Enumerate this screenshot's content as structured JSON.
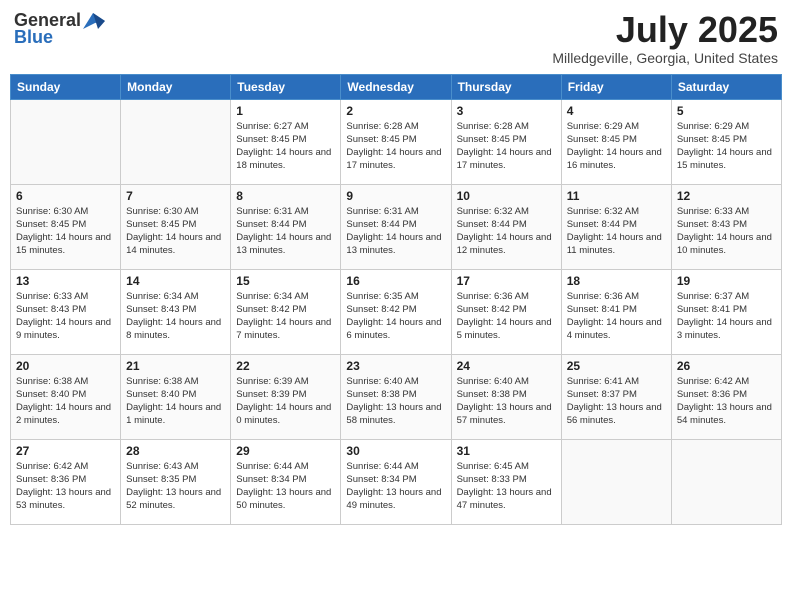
{
  "header": {
    "logo_general": "General",
    "logo_blue": "Blue",
    "month": "July 2025",
    "location": "Milledgeville, Georgia, United States"
  },
  "days_of_week": [
    "Sunday",
    "Monday",
    "Tuesday",
    "Wednesday",
    "Thursday",
    "Friday",
    "Saturday"
  ],
  "weeks": [
    [
      {
        "day": "",
        "info": ""
      },
      {
        "day": "",
        "info": ""
      },
      {
        "day": "1",
        "info": "Sunrise: 6:27 AM\nSunset: 8:45 PM\nDaylight: 14 hours and 18 minutes."
      },
      {
        "day": "2",
        "info": "Sunrise: 6:28 AM\nSunset: 8:45 PM\nDaylight: 14 hours and 17 minutes."
      },
      {
        "day": "3",
        "info": "Sunrise: 6:28 AM\nSunset: 8:45 PM\nDaylight: 14 hours and 17 minutes."
      },
      {
        "day": "4",
        "info": "Sunrise: 6:29 AM\nSunset: 8:45 PM\nDaylight: 14 hours and 16 minutes."
      },
      {
        "day": "5",
        "info": "Sunrise: 6:29 AM\nSunset: 8:45 PM\nDaylight: 14 hours and 15 minutes."
      }
    ],
    [
      {
        "day": "6",
        "info": "Sunrise: 6:30 AM\nSunset: 8:45 PM\nDaylight: 14 hours and 15 minutes."
      },
      {
        "day": "7",
        "info": "Sunrise: 6:30 AM\nSunset: 8:45 PM\nDaylight: 14 hours and 14 minutes."
      },
      {
        "day": "8",
        "info": "Sunrise: 6:31 AM\nSunset: 8:44 PM\nDaylight: 14 hours and 13 minutes."
      },
      {
        "day": "9",
        "info": "Sunrise: 6:31 AM\nSunset: 8:44 PM\nDaylight: 14 hours and 13 minutes."
      },
      {
        "day": "10",
        "info": "Sunrise: 6:32 AM\nSunset: 8:44 PM\nDaylight: 14 hours and 12 minutes."
      },
      {
        "day": "11",
        "info": "Sunrise: 6:32 AM\nSunset: 8:44 PM\nDaylight: 14 hours and 11 minutes."
      },
      {
        "day": "12",
        "info": "Sunrise: 6:33 AM\nSunset: 8:43 PM\nDaylight: 14 hours and 10 minutes."
      }
    ],
    [
      {
        "day": "13",
        "info": "Sunrise: 6:33 AM\nSunset: 8:43 PM\nDaylight: 14 hours and 9 minutes."
      },
      {
        "day": "14",
        "info": "Sunrise: 6:34 AM\nSunset: 8:43 PM\nDaylight: 14 hours and 8 minutes."
      },
      {
        "day": "15",
        "info": "Sunrise: 6:34 AM\nSunset: 8:42 PM\nDaylight: 14 hours and 7 minutes."
      },
      {
        "day": "16",
        "info": "Sunrise: 6:35 AM\nSunset: 8:42 PM\nDaylight: 14 hours and 6 minutes."
      },
      {
        "day": "17",
        "info": "Sunrise: 6:36 AM\nSunset: 8:42 PM\nDaylight: 14 hours and 5 minutes."
      },
      {
        "day": "18",
        "info": "Sunrise: 6:36 AM\nSunset: 8:41 PM\nDaylight: 14 hours and 4 minutes."
      },
      {
        "day": "19",
        "info": "Sunrise: 6:37 AM\nSunset: 8:41 PM\nDaylight: 14 hours and 3 minutes."
      }
    ],
    [
      {
        "day": "20",
        "info": "Sunrise: 6:38 AM\nSunset: 8:40 PM\nDaylight: 14 hours and 2 minutes."
      },
      {
        "day": "21",
        "info": "Sunrise: 6:38 AM\nSunset: 8:40 PM\nDaylight: 14 hours and 1 minute."
      },
      {
        "day": "22",
        "info": "Sunrise: 6:39 AM\nSunset: 8:39 PM\nDaylight: 14 hours and 0 minutes."
      },
      {
        "day": "23",
        "info": "Sunrise: 6:40 AM\nSunset: 8:38 PM\nDaylight: 13 hours and 58 minutes."
      },
      {
        "day": "24",
        "info": "Sunrise: 6:40 AM\nSunset: 8:38 PM\nDaylight: 13 hours and 57 minutes."
      },
      {
        "day": "25",
        "info": "Sunrise: 6:41 AM\nSunset: 8:37 PM\nDaylight: 13 hours and 56 minutes."
      },
      {
        "day": "26",
        "info": "Sunrise: 6:42 AM\nSunset: 8:36 PM\nDaylight: 13 hours and 54 minutes."
      }
    ],
    [
      {
        "day": "27",
        "info": "Sunrise: 6:42 AM\nSunset: 8:36 PM\nDaylight: 13 hours and 53 minutes."
      },
      {
        "day": "28",
        "info": "Sunrise: 6:43 AM\nSunset: 8:35 PM\nDaylight: 13 hours and 52 minutes."
      },
      {
        "day": "29",
        "info": "Sunrise: 6:44 AM\nSunset: 8:34 PM\nDaylight: 13 hours and 50 minutes."
      },
      {
        "day": "30",
        "info": "Sunrise: 6:44 AM\nSunset: 8:34 PM\nDaylight: 13 hours and 49 minutes."
      },
      {
        "day": "31",
        "info": "Sunrise: 6:45 AM\nSunset: 8:33 PM\nDaylight: 13 hours and 47 minutes."
      },
      {
        "day": "",
        "info": ""
      },
      {
        "day": "",
        "info": ""
      }
    ]
  ]
}
